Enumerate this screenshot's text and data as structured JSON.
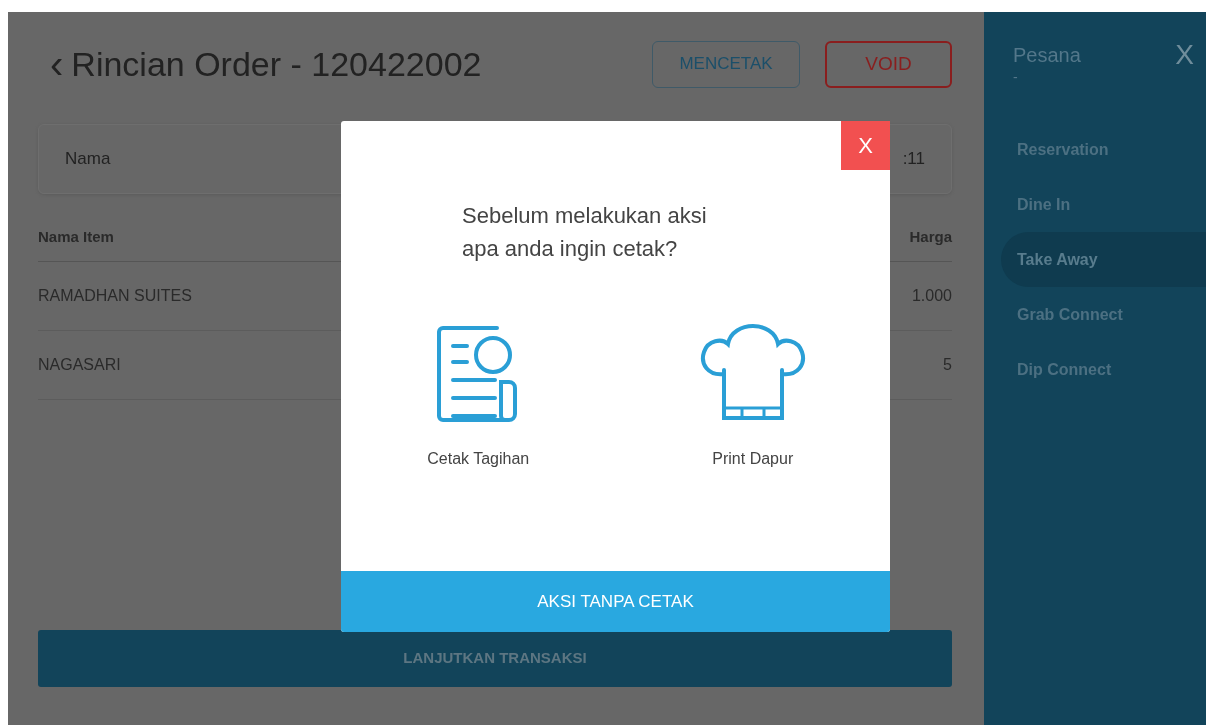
{
  "header": {
    "back_icon": "‹",
    "title": "Rincian Order - 120422002",
    "buttons": [
      {
        "label": "MENCETAK",
        "kind": "print"
      },
      {
        "label": "VOID",
        "kind": "void"
      }
    ]
  },
  "info_card": {
    "label": "Nama",
    "value": ":11"
  },
  "table": {
    "columns": [
      "Nama Item",
      "Harga"
    ],
    "rows": [
      {
        "name": "RAMADHAN SUITES",
        "price": "1.000"
      },
      {
        "name": "NAGASARI",
        "price": "5"
      }
    ]
  },
  "continue_button": "LANJUTKAN TRANSAKSI",
  "sidebar": {
    "title": "Pesana",
    "subtitle": "-",
    "close": "X",
    "items": [
      {
        "label": "Reservation",
        "selected": false
      },
      {
        "label": "Dine In",
        "selected": false
      },
      {
        "label": "Take Away",
        "selected": true
      },
      {
        "label": "Grab Connect",
        "selected": false
      },
      {
        "label": "Dip Connect",
        "selected": false
      }
    ]
  },
  "dialog": {
    "close": "X",
    "question": "Sebelum melakukan aksi\napa anda ingin cetak?",
    "options": [
      {
        "kind": "bill",
        "label": "Cetak Tagihan"
      },
      {
        "kind": "kitchen",
        "label": "Print Dapur"
      }
    ],
    "footer_button": "AKSI TANPA CETAK"
  }
}
